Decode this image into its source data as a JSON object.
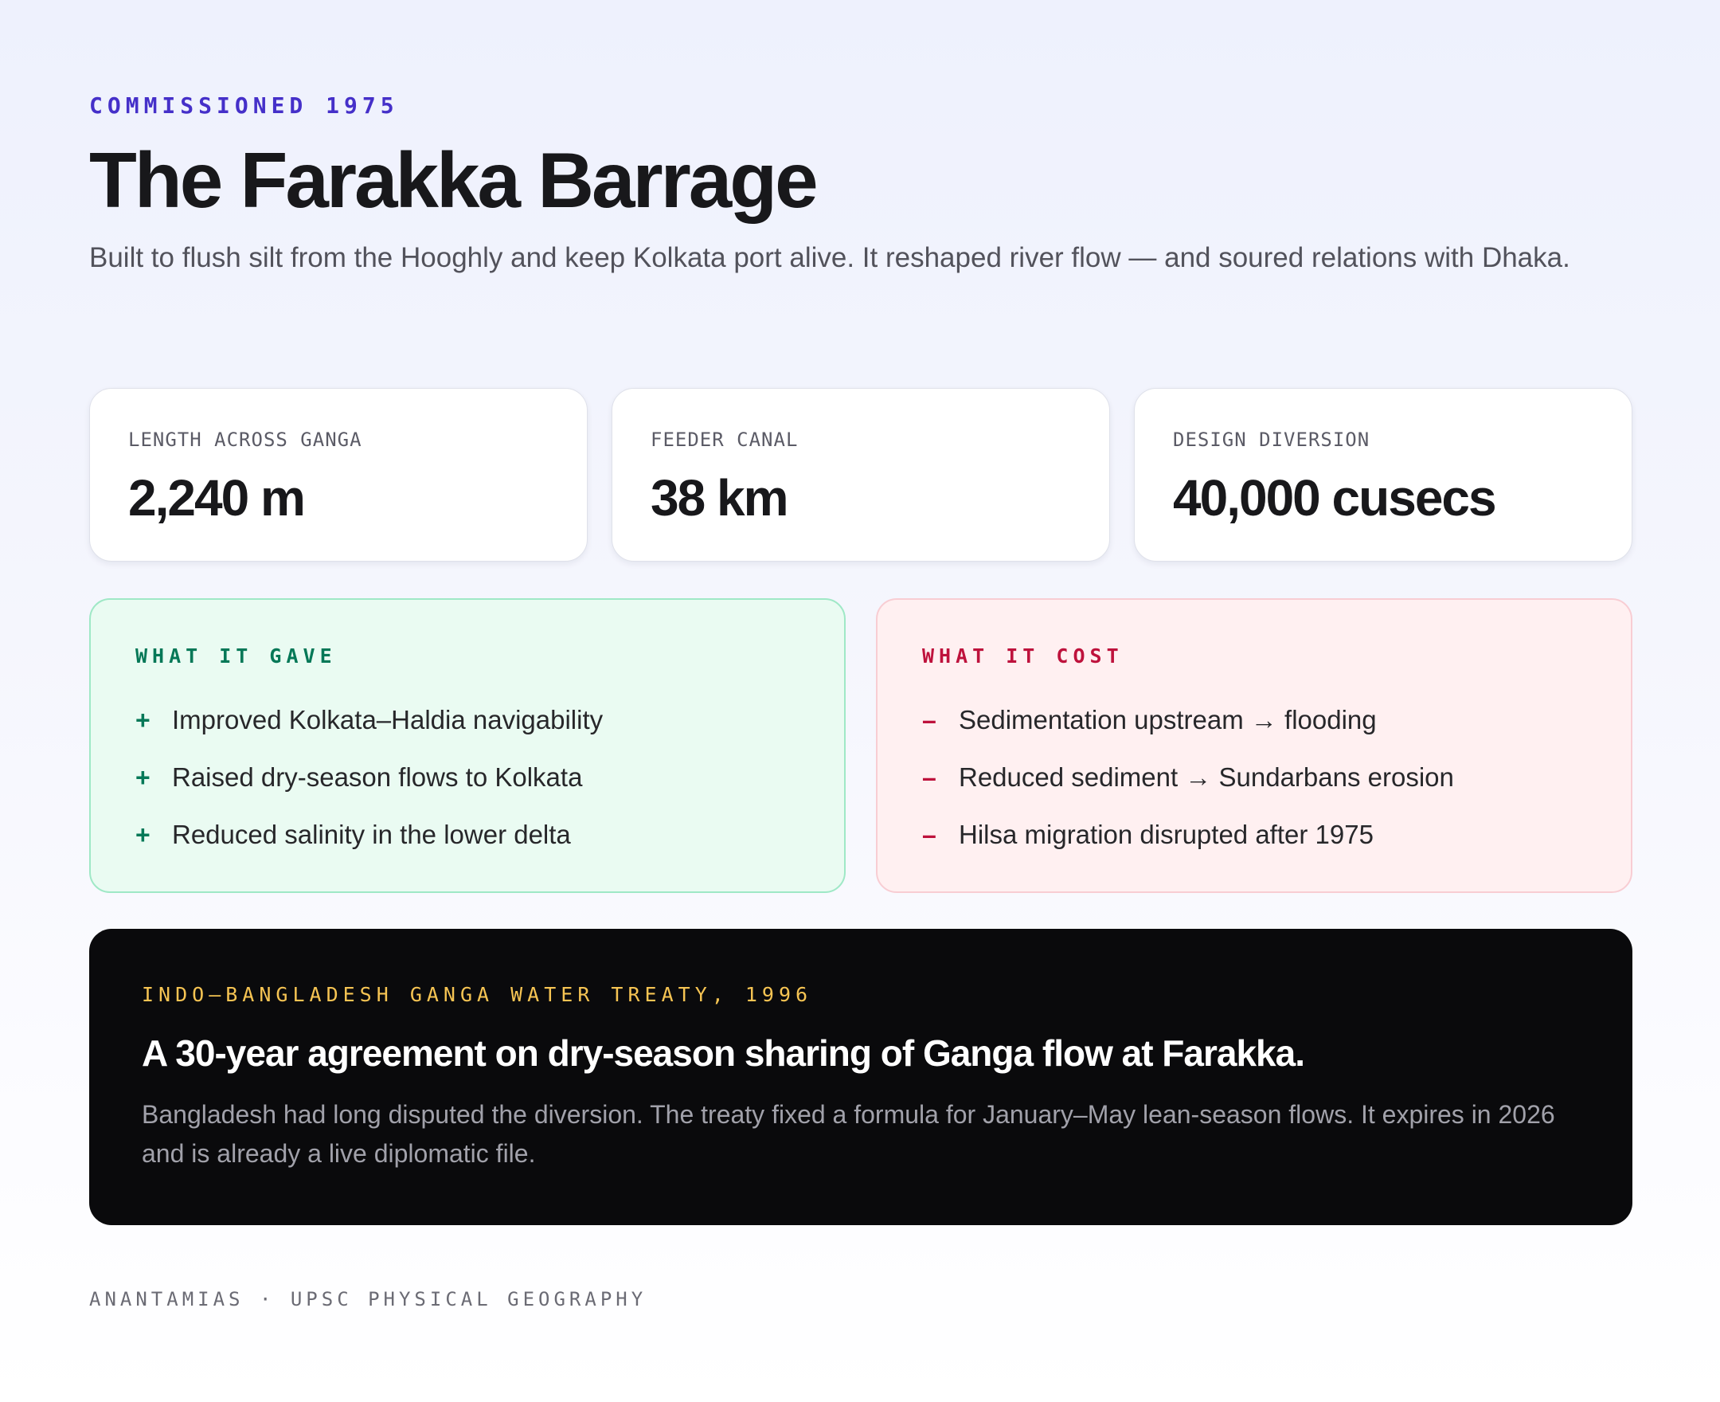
{
  "header": {
    "eyebrow": "COMMISSIONED 1975",
    "title": "The Farakka Barrage",
    "subtitle": "Built to flush silt from the Hooghly and keep Kolkata port alive. It reshaped river flow — and soured relations with Dhaka."
  },
  "stats": [
    {
      "label": "LENGTH ACROSS GANGA",
      "value": "2,240 m"
    },
    {
      "label": "FEEDER CANAL",
      "value": "38 km"
    },
    {
      "label": "DESIGN DIVERSION",
      "value": "40,000 cusecs"
    }
  ],
  "gave": {
    "heading": "WHAT IT GAVE",
    "marker": "+",
    "items": [
      "Improved Kolkata–Haldia navigability",
      "Raised dry-season flows to Kolkata",
      "Reduced salinity in the lower delta"
    ]
  },
  "cost": {
    "heading": "WHAT IT COST",
    "marker": "–",
    "items": [
      "Sedimentation upstream → flooding",
      "Reduced sediment → Sundarbans erosion",
      "Hilsa migration disrupted after 1975"
    ]
  },
  "treaty": {
    "eyebrow": "INDO–BANGLADESH GANGA WATER TREATY, 1996",
    "title": "A 30-year agreement on dry-season sharing of Ganga flow at Farakka.",
    "body": "Bangladesh had long disputed the diversion. The treaty fixed a formula for January–May lean-season flows. It expires in 2026 and is already a live diplomatic file."
  },
  "footer": {
    "text": "ANANTAMIAS · UPSC PHYSICAL GEOGRAPHY"
  },
  "colors": {
    "accent": "#4530c9",
    "positive": "#047857",
    "negative": "#be123c",
    "treaty_accent": "#f6c453",
    "treaty_background": "#0a0a0c"
  }
}
